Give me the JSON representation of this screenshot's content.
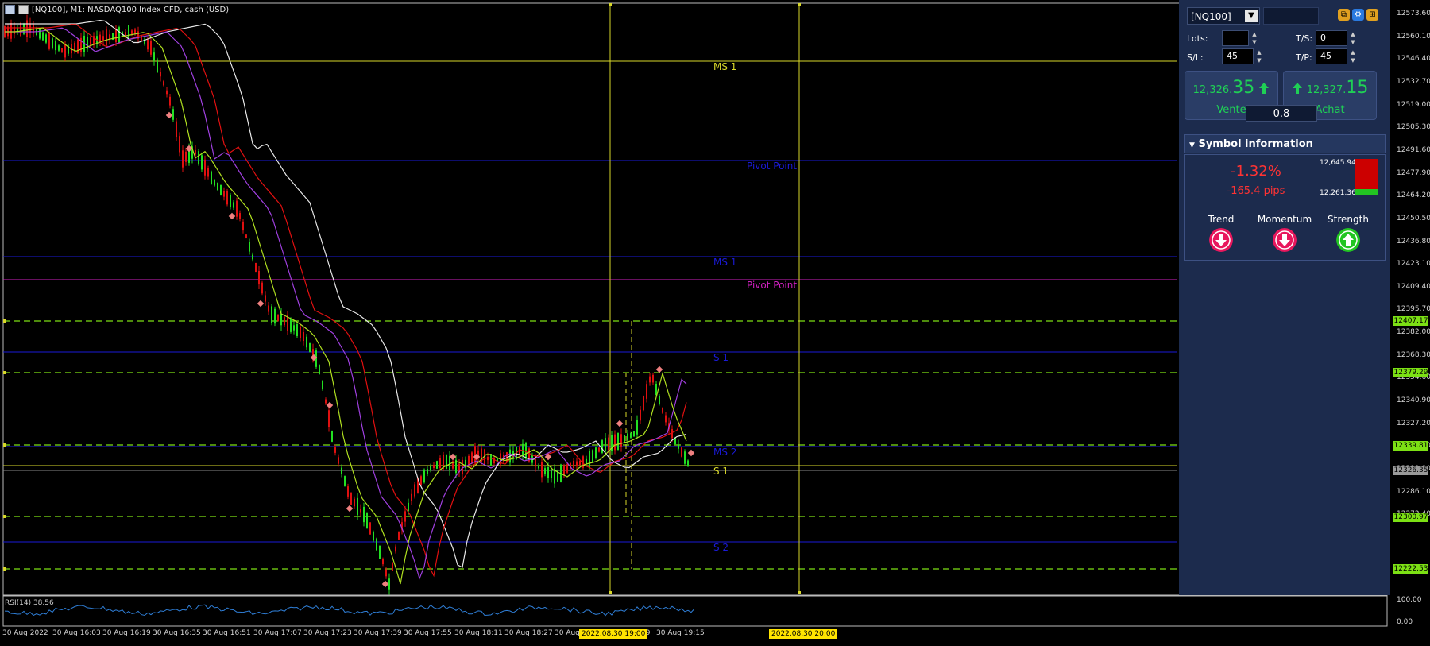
{
  "header": {
    "title": "[NQ100], M1:  NASDAQ100 Index CFD, cash (USD)"
  },
  "price_axis": [
    "12573.60",
    "12560.10",
    "12546.40",
    "12532.70",
    "12519.00",
    "12505.30",
    "12491.60",
    "12477.90",
    "12464.20",
    "12450.50",
    "12436.80",
    "12423.10",
    "12409.40",
    "12395.70",
    "12382.00",
    "12368.30",
    "12354.60",
    "12340.90",
    "12327.20",
    "12313.50",
    "12299.80",
    "12286.10",
    "12272.40"
  ],
  "price_tags": [
    {
      "label": "12407.17",
      "color": "#7ce014"
    },
    {
      "label": "12379.29",
      "color": "#7ce014"
    },
    {
      "label": "12339.81",
      "color": "#7ce014"
    },
    {
      "label": "12326.35",
      "color": "#9a9a9a"
    },
    {
      "label": "12300.97",
      "color": "#7ce014"
    },
    {
      "label": "12222.53",
      "color": "#7ce014"
    }
  ],
  "levels": [
    {
      "label": "MS 1",
      "color": "#d8d82a"
    },
    {
      "label": "Pivot Point",
      "color": "#1a1ad8"
    },
    {
      "label": "MS 1",
      "color": "#1a1ad8"
    },
    {
      "label": "Pivot Point",
      "color": "#d020c0"
    },
    {
      "label": "S 1",
      "color": "#1a1ad8"
    },
    {
      "label": "MS 2",
      "color": "#1a1ad8"
    },
    {
      "label": "S 1",
      "color": "#d8d82a"
    },
    {
      "label": "S 2",
      "color": "#1a1ad8"
    }
  ],
  "time_axis": [
    "30 Aug 2022",
    "30 Aug 16:03",
    "30 Aug 16:19",
    "30 Aug 16:35",
    "30 Aug 16:51",
    "30 Aug 17:07",
    "30 Aug 17:23",
    "30 Aug 17:39",
    "30 Aug 17:55",
    "30 Aug 18:11",
    "30 Aug 18:27",
    "30 Aug",
    "59",
    "30 Aug 19:15"
  ],
  "time_highlights": [
    "2022.08.30 19:00",
    "2022.08.30 20:00"
  ],
  "rsi": {
    "label": "RSI(14) 38.56",
    "axis": [
      "100.00",
      "0.00"
    ]
  },
  "panel": {
    "symbol": "[NQ100]",
    "lots_label": "Lots:",
    "lots_value": "",
    "ts_label": "T/S:",
    "ts_value": "0",
    "sl_label": "S/L:",
    "sl_value": "45",
    "tp_label": "T/P:",
    "tp_value": "45",
    "sell": {
      "price_small": "12,326.",
      "price_big": "35",
      "label": "Vente"
    },
    "buy": {
      "price_small": "12,327.",
      "price_big": "15",
      "label": "Achat"
    },
    "spread": "0.8",
    "symbol_info": {
      "title": "Symbol information",
      "change_pct": "-1.32%",
      "change_pips": "-165.4 pips",
      "high": "12,645.94",
      "low": "12,261.36",
      "indicators": [
        {
          "label": "Trend",
          "direction": "down",
          "color": "#e8175d"
        },
        {
          "label": "Momentum",
          "direction": "down",
          "color": "#e8175d"
        },
        {
          "label": "Strength",
          "direction": "up",
          "color": "#22c522"
        }
      ]
    }
  },
  "colors": {
    "bull": "#22e022",
    "bear": "#e01010",
    "panel_bg": "#1c2b4d",
    "accent": "#1fd055"
  }
}
